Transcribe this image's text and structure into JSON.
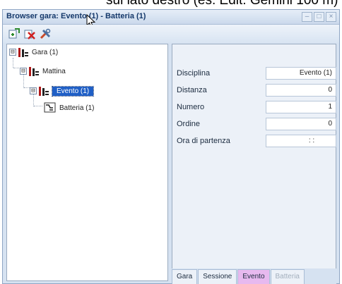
{
  "background_caption": "sul lato destro (es. Edit. Gemini 100 m)",
  "window": {
    "title": "Browser gara: Evento (1) - Batteria (1)",
    "controls": [
      "–",
      "□",
      "×"
    ]
  },
  "toolbar": {
    "buttons": [
      "add-icon",
      "delete-icon",
      "tools-icon"
    ]
  },
  "tree": {
    "nodes": [
      {
        "label": "Gara (1)",
        "expander": "⊟"
      },
      {
        "label": "Mattina",
        "expander": "⊟"
      },
      {
        "label": "Evento (1)",
        "expander": "⊟",
        "selected": true
      },
      {
        "label": "Batteria (1)"
      }
    ]
  },
  "properties": [
    {
      "label": "Disciplina",
      "value": "Evento (1)"
    },
    {
      "label": "Distanza",
      "value": "0"
    },
    {
      "label": "Numero",
      "value": "1"
    },
    {
      "label": "Ordine",
      "value": "0"
    },
    {
      "label": "Ora di partenza",
      "value": ": :"
    }
  ],
  "tabs": [
    {
      "label": "Gara"
    },
    {
      "label": "Sessione"
    },
    {
      "label": "Evento",
      "active": true
    },
    {
      "label": "Batteria",
      "disabled": true
    }
  ],
  "colors": {
    "selected_node": "#1f5fc6",
    "active_tab": "#e7b9ef",
    "panel_bg": "#ecf1f8",
    "window_bg": "#d6e2f1"
  }
}
